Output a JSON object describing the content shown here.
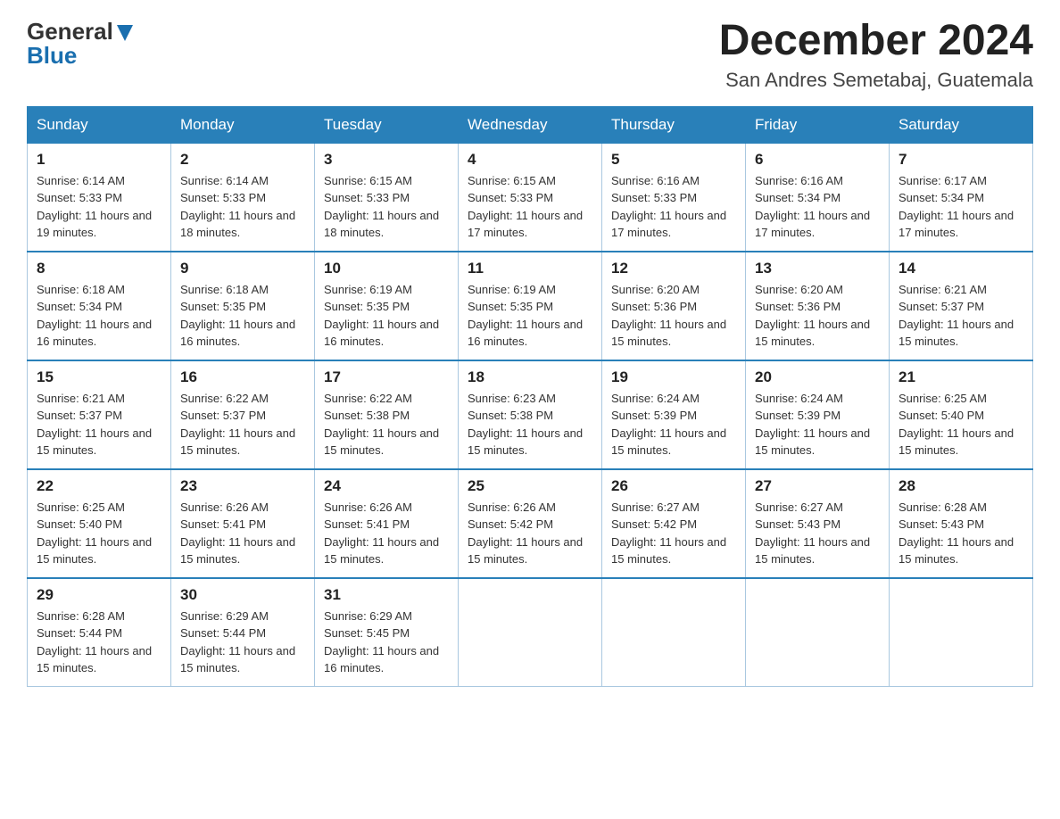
{
  "header": {
    "logo_general": "General",
    "logo_blue": "Blue",
    "month_title": "December 2024",
    "location": "San Andres Semetabaj, Guatemala"
  },
  "weekdays": [
    "Sunday",
    "Monday",
    "Tuesday",
    "Wednesday",
    "Thursday",
    "Friday",
    "Saturday"
  ],
  "weeks": [
    [
      {
        "day": "1",
        "sunrise": "6:14 AM",
        "sunset": "5:33 PM",
        "daylight": "11 hours and 19 minutes."
      },
      {
        "day": "2",
        "sunrise": "6:14 AM",
        "sunset": "5:33 PM",
        "daylight": "11 hours and 18 minutes."
      },
      {
        "day": "3",
        "sunrise": "6:15 AM",
        "sunset": "5:33 PM",
        "daylight": "11 hours and 18 minutes."
      },
      {
        "day": "4",
        "sunrise": "6:15 AM",
        "sunset": "5:33 PM",
        "daylight": "11 hours and 17 minutes."
      },
      {
        "day": "5",
        "sunrise": "6:16 AM",
        "sunset": "5:33 PM",
        "daylight": "11 hours and 17 minutes."
      },
      {
        "day": "6",
        "sunrise": "6:16 AM",
        "sunset": "5:34 PM",
        "daylight": "11 hours and 17 minutes."
      },
      {
        "day": "7",
        "sunrise": "6:17 AM",
        "sunset": "5:34 PM",
        "daylight": "11 hours and 17 minutes."
      }
    ],
    [
      {
        "day": "8",
        "sunrise": "6:18 AM",
        "sunset": "5:34 PM",
        "daylight": "11 hours and 16 minutes."
      },
      {
        "day": "9",
        "sunrise": "6:18 AM",
        "sunset": "5:35 PM",
        "daylight": "11 hours and 16 minutes."
      },
      {
        "day": "10",
        "sunrise": "6:19 AM",
        "sunset": "5:35 PM",
        "daylight": "11 hours and 16 minutes."
      },
      {
        "day": "11",
        "sunrise": "6:19 AM",
        "sunset": "5:35 PM",
        "daylight": "11 hours and 16 minutes."
      },
      {
        "day": "12",
        "sunrise": "6:20 AM",
        "sunset": "5:36 PM",
        "daylight": "11 hours and 15 minutes."
      },
      {
        "day": "13",
        "sunrise": "6:20 AM",
        "sunset": "5:36 PM",
        "daylight": "11 hours and 15 minutes."
      },
      {
        "day": "14",
        "sunrise": "6:21 AM",
        "sunset": "5:37 PM",
        "daylight": "11 hours and 15 minutes."
      }
    ],
    [
      {
        "day": "15",
        "sunrise": "6:21 AM",
        "sunset": "5:37 PM",
        "daylight": "11 hours and 15 minutes."
      },
      {
        "day": "16",
        "sunrise": "6:22 AM",
        "sunset": "5:37 PM",
        "daylight": "11 hours and 15 minutes."
      },
      {
        "day": "17",
        "sunrise": "6:22 AM",
        "sunset": "5:38 PM",
        "daylight": "11 hours and 15 minutes."
      },
      {
        "day": "18",
        "sunrise": "6:23 AM",
        "sunset": "5:38 PM",
        "daylight": "11 hours and 15 minutes."
      },
      {
        "day": "19",
        "sunrise": "6:24 AM",
        "sunset": "5:39 PM",
        "daylight": "11 hours and 15 minutes."
      },
      {
        "day": "20",
        "sunrise": "6:24 AM",
        "sunset": "5:39 PM",
        "daylight": "11 hours and 15 minutes."
      },
      {
        "day": "21",
        "sunrise": "6:25 AM",
        "sunset": "5:40 PM",
        "daylight": "11 hours and 15 minutes."
      }
    ],
    [
      {
        "day": "22",
        "sunrise": "6:25 AM",
        "sunset": "5:40 PM",
        "daylight": "11 hours and 15 minutes."
      },
      {
        "day": "23",
        "sunrise": "6:26 AM",
        "sunset": "5:41 PM",
        "daylight": "11 hours and 15 minutes."
      },
      {
        "day": "24",
        "sunrise": "6:26 AM",
        "sunset": "5:41 PM",
        "daylight": "11 hours and 15 minutes."
      },
      {
        "day": "25",
        "sunrise": "6:26 AM",
        "sunset": "5:42 PM",
        "daylight": "11 hours and 15 minutes."
      },
      {
        "day": "26",
        "sunrise": "6:27 AM",
        "sunset": "5:42 PM",
        "daylight": "11 hours and 15 minutes."
      },
      {
        "day": "27",
        "sunrise": "6:27 AM",
        "sunset": "5:43 PM",
        "daylight": "11 hours and 15 minutes."
      },
      {
        "day": "28",
        "sunrise": "6:28 AM",
        "sunset": "5:43 PM",
        "daylight": "11 hours and 15 minutes."
      }
    ],
    [
      {
        "day": "29",
        "sunrise": "6:28 AM",
        "sunset": "5:44 PM",
        "daylight": "11 hours and 15 minutes."
      },
      {
        "day": "30",
        "sunrise": "6:29 AM",
        "sunset": "5:44 PM",
        "daylight": "11 hours and 15 minutes."
      },
      {
        "day": "31",
        "sunrise": "6:29 AM",
        "sunset": "5:45 PM",
        "daylight": "11 hours and 16 minutes."
      },
      null,
      null,
      null,
      null
    ]
  ]
}
